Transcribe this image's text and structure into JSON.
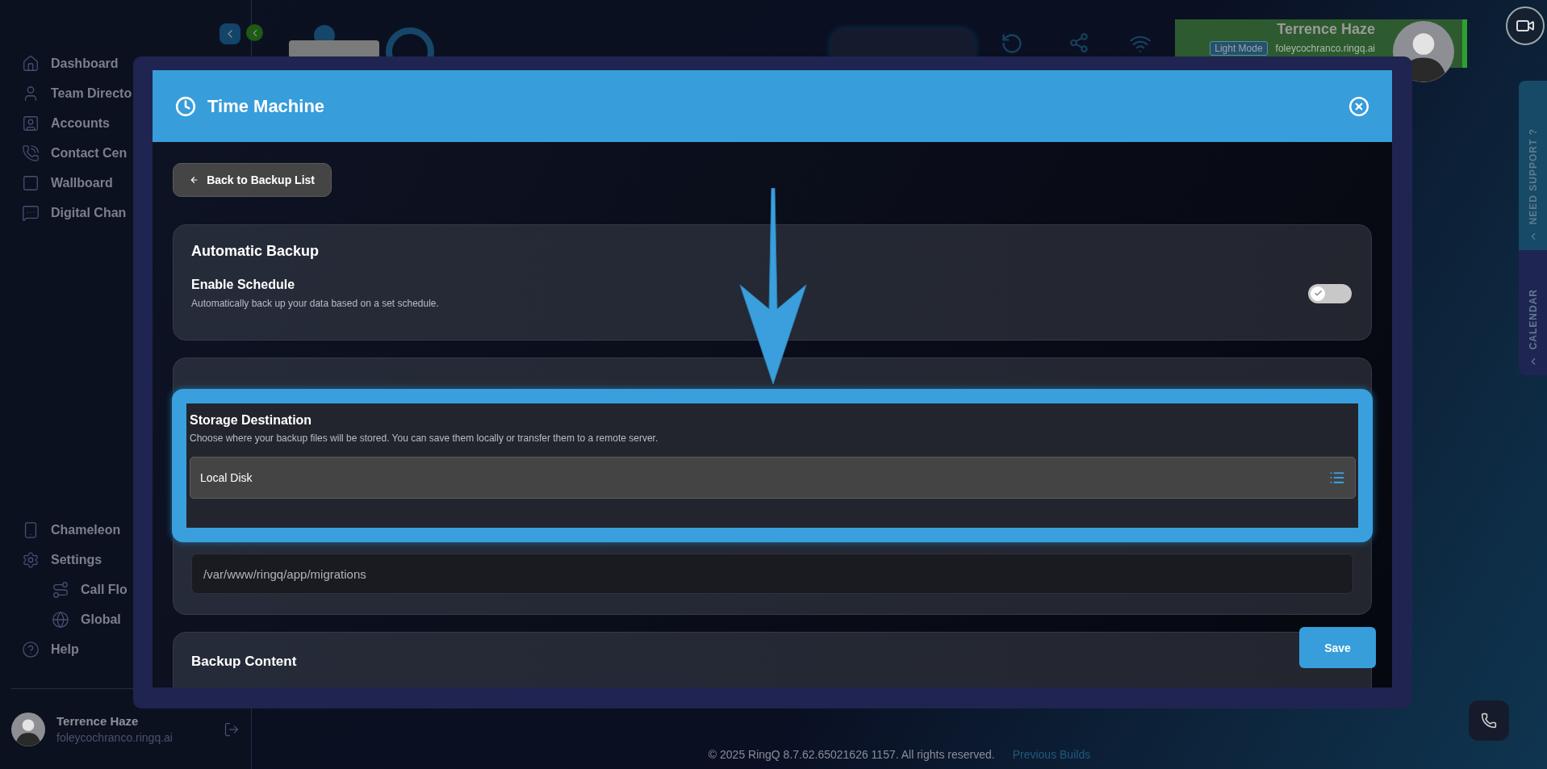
{
  "sidebar": {
    "items": [
      {
        "label": "Dashboard"
      },
      {
        "label": "Team Directo"
      },
      {
        "label": "Accounts"
      },
      {
        "label": "Contact Cen"
      },
      {
        "label": "Wallboard"
      },
      {
        "label": "Digital Chan"
      }
    ],
    "bottom_items": [
      {
        "label": "Chameleon"
      },
      {
        "label": "Settings",
        "children": [
          {
            "label": "Call Flo"
          },
          {
            "label": "Global"
          }
        ]
      },
      {
        "label": "Help"
      }
    ],
    "user": {
      "name": "Terrence Haze",
      "email": "foleycochranco.ringq.ai"
    }
  },
  "header": {
    "user_card": {
      "name": "Terrence Haze",
      "mode_badge": "Light Mode",
      "email": "foleycochranco.ringq.ai"
    }
  },
  "side_tabs": [
    {
      "label": "NEED SUPPORT ?",
      "color": "#164a66"
    },
    {
      "label": "CALENDAR",
      "color": "#1f2552"
    }
  ],
  "modal": {
    "title": "Time Machine",
    "back_button": "Back to Backup List",
    "automatic_backup": {
      "title": "Automatic Backup",
      "enable_schedule": {
        "label": "Enable Schedule",
        "description": "Automatically back up your data based on a set schedule.",
        "on": false
      }
    },
    "storage_destination": {
      "label": "Storage Destination",
      "description": "Choose where your backup files will be stored. You can save them locally or transfer them to a remote server.",
      "value": "Local Disk"
    },
    "path": {
      "value": "/var/www/ringq/app/migrations"
    },
    "backup_content": {
      "title": "Backup Content"
    },
    "save_button": "Save"
  },
  "footer": {
    "copyright": "© 2025 RingQ 8.7.62.65021626 1157. All rights reserved.",
    "link": "Previous Builds"
  }
}
